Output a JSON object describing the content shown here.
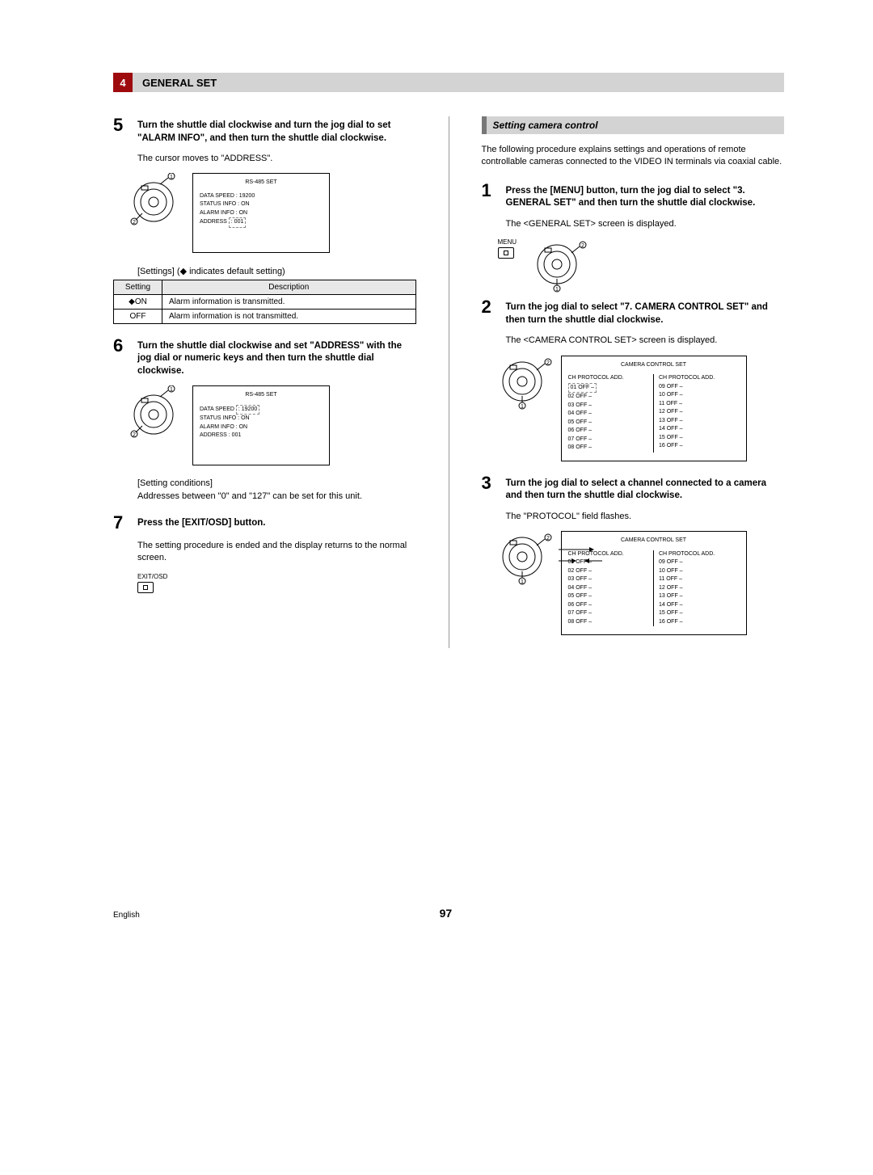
{
  "header": {
    "num": "4",
    "title": "GENERAL SET"
  },
  "left": {
    "step5": {
      "num": "5",
      "text": "Turn the shuttle dial clockwise and turn the jog dial to set \"ALARM INFO\", and then turn the shuttle dial clockwise.",
      "body": "The cursor moves to \"ADDRESS\".",
      "screen": {
        "title": "RS-485 SET",
        "line1": "DATA SPEED : 19200",
        "line2": "STATUS INFO : ON",
        "line3": "ALARM INFO : ON",
        "line4_label": "ADDRESS",
        "line4_value": ": 001"
      },
      "table_caption": "[Settings] (◆ indicates default setting)",
      "table": {
        "h1": "Setting",
        "h2": "Description",
        "r1c1": "◆ON",
        "r1c2": "Alarm information is transmitted.",
        "r2c1": "OFF",
        "r2c2": "Alarm information is not transmitted."
      }
    },
    "step6": {
      "num": "6",
      "text": "Turn the shuttle dial clockwise and set \"ADDRESS\" with the jog dial or numeric keys and then turn the shuttle dial clockwise.",
      "screen": {
        "title": "RS-485 SET",
        "line1_label": "DATA SPEED",
        "line1_value": ": 19200",
        "line2": "STATUS INFO : ON",
        "line3": "ALARM INFO : ON",
        "line4": "ADDRESS : 001"
      },
      "note1": "[Setting conditions]",
      "note2": "Addresses between \"0\" and \"127\" can be set for this unit."
    },
    "step7": {
      "num": "7",
      "text": "Press the [EXIT/OSD] button.",
      "body": "The setting procedure is ended and the display returns to the normal screen.",
      "btn_label": "EXIT/OSD"
    }
  },
  "right": {
    "subheader": "Setting camera control",
    "intro": "The following procedure explains settings and operations of remote controllable cameras connected to the VIDEO IN terminals via coaxial cable.",
    "step1": {
      "num": "1",
      "text": "Press the [MENU] button, turn the jog dial to select \"3. GENERAL SET\" and then turn the shuttle dial clockwise.",
      "body": "The <GENERAL SET> screen is displayed.",
      "btn_label": "MENU"
    },
    "step2": {
      "num": "2",
      "text": "Turn the jog dial to select \"7. CAMERA CONTROL SET\" and then turn the shuttle dial clockwise.",
      "body": "The <CAMERA CONTROL SET> screen is displayed.",
      "screen": {
        "title": "CAMERA CONTROL SET",
        "header_l": "CH PROTOCOL  ADD.",
        "header_r": "CH PROTOCOL  ADD.",
        "rows_l": [
          "01 OFF     –",
          "02 OFF     –",
          "03 OFF     –",
          "04 OFF     –",
          "05 OFF     –",
          "06 OFF     –",
          "07 OFF     –",
          "08 OFF     –"
        ],
        "rows_r": [
          "09 OFF     –",
          "10 OFF     –",
          "11 OFF     –",
          "12 OFF     –",
          "13 OFF     –",
          "14 OFF     –",
          "15 OFF     –",
          "16 OFF     –"
        ]
      }
    },
    "step3": {
      "num": "3",
      "text": "Turn the jog dial to select a channel connected to a camera and then turn the shuttle dial clockwise.",
      "body": "The \"PROTOCOL\" field flashes.",
      "screen": {
        "title": "CAMERA CONTROL SET",
        "header_l": "CH PROTOCOL  ADD.",
        "header_r": "CH PROTOCOL  ADD.",
        "rows_l": [
          "01 OFF     –",
          "02 OFF     –",
          "03 OFF     –",
          "04 OFF     –",
          "05 OFF     –",
          "06 OFF     –",
          "07 OFF     –",
          "08 OFF     –"
        ],
        "rows_r": [
          "09 OFF     –",
          "10 OFF     –",
          "11 OFF     –",
          "12 OFF     –",
          "13 OFF     –",
          "14 OFF     –",
          "15 OFF     –",
          "16 OFF     –"
        ]
      }
    }
  },
  "footer": {
    "lang": "English",
    "page": "97"
  }
}
